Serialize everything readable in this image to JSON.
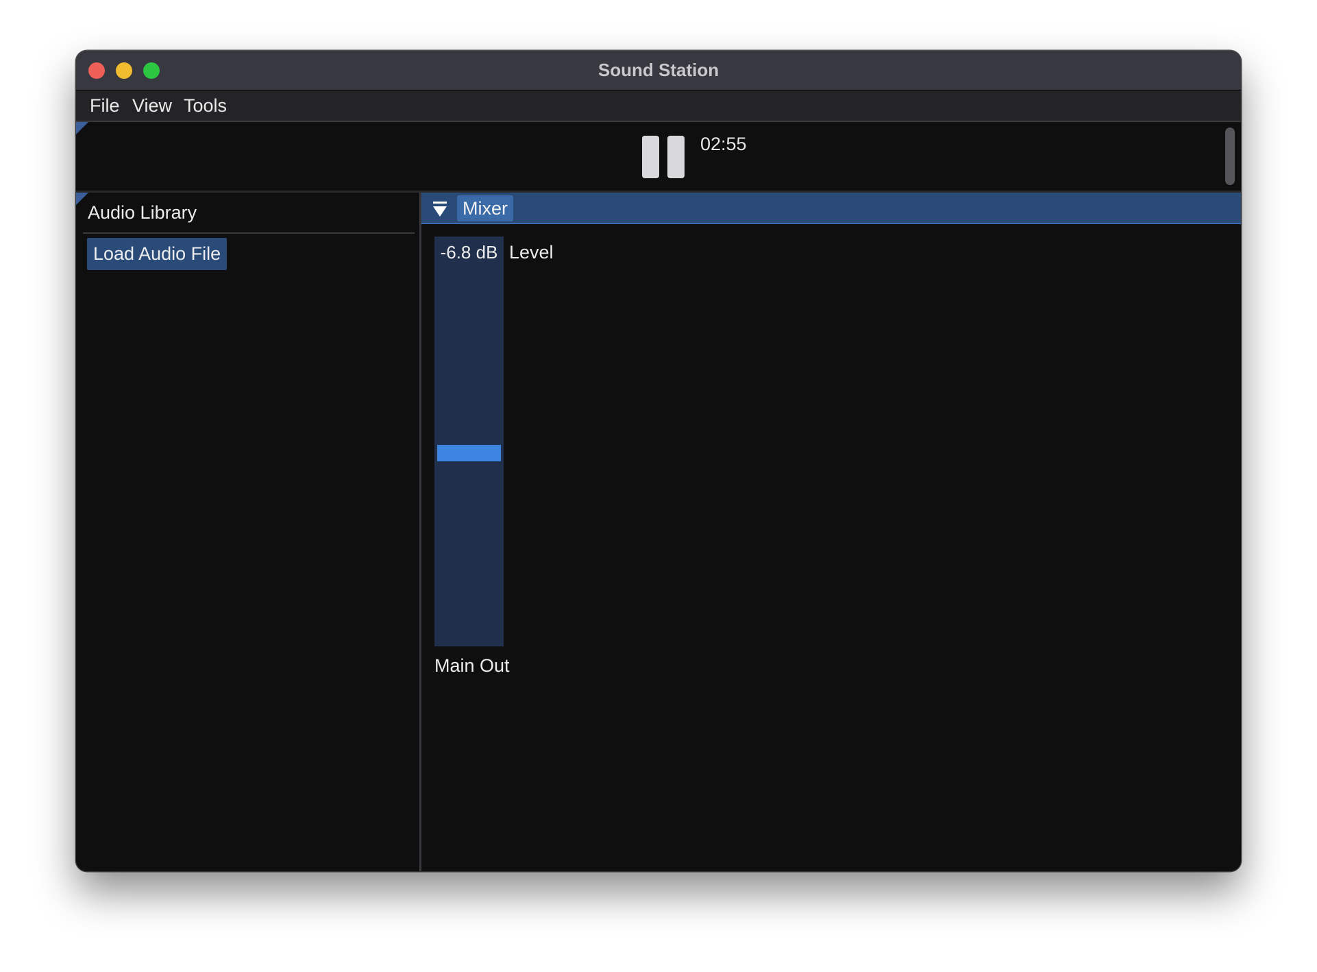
{
  "window": {
    "title": "Sound Station"
  },
  "menubar": {
    "items": [
      "File",
      "View",
      "Tools"
    ]
  },
  "transport": {
    "play_state_icon": "pause-icon",
    "time": "02:55"
  },
  "library": {
    "title": "Audio Library",
    "load_button_label": "Load Audio File"
  },
  "mixer": {
    "header_label": "Mixer",
    "collapse_icon": "triangle-down-icon",
    "fader": {
      "value_text": "-6.8 dB",
      "param_label": "Level",
      "level_fraction": 0.47
    },
    "channel_label": "Main Out",
    "accent_color": "#3d85e0",
    "header_color": "#2a4a78"
  }
}
